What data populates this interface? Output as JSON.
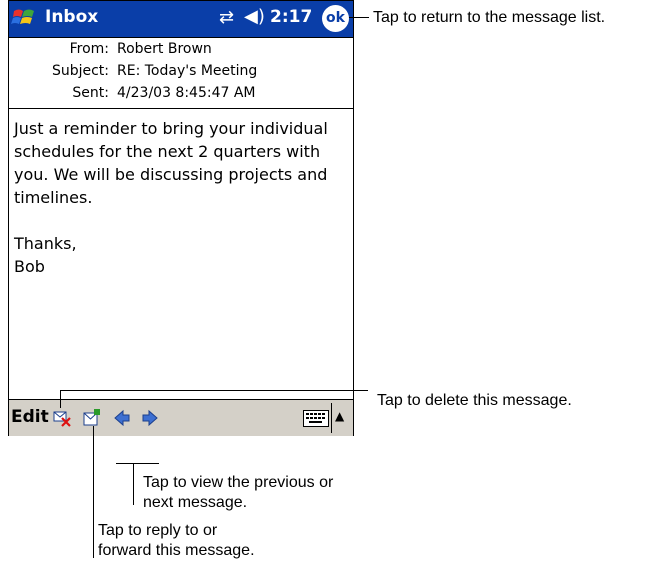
{
  "titlebar": {
    "app_title": "Inbox",
    "clock": "2:17",
    "ok_label": "ok"
  },
  "header": {
    "from_label": "From:",
    "from_value": "Robert Brown",
    "subject_label": "Subject:",
    "subject_value": "RE: Today's Meeting",
    "sent_label": "Sent:",
    "sent_value": "4/23/03 8:45:47 AM"
  },
  "body": "Just a reminder to bring your individual\nschedules for the next 2 quarters with\nyou. We will be discussing projects and\ntimelines.\n\nThanks,\nBob",
  "cmdbar": {
    "edit_label": "Edit"
  },
  "callouts": {
    "ok": "Tap to return to the message list.",
    "delete": "Tap to delete this message.",
    "prevnext": "Tap to view the previous or\nnext message.",
    "reply": "Tap to reply to or\nforward this message."
  },
  "icons": [
    "windows-start-icon",
    "connectivity-icon",
    "volume-icon",
    "delete-icon",
    "reply-icon",
    "previous-icon",
    "next-icon",
    "keyboard-icon"
  ]
}
